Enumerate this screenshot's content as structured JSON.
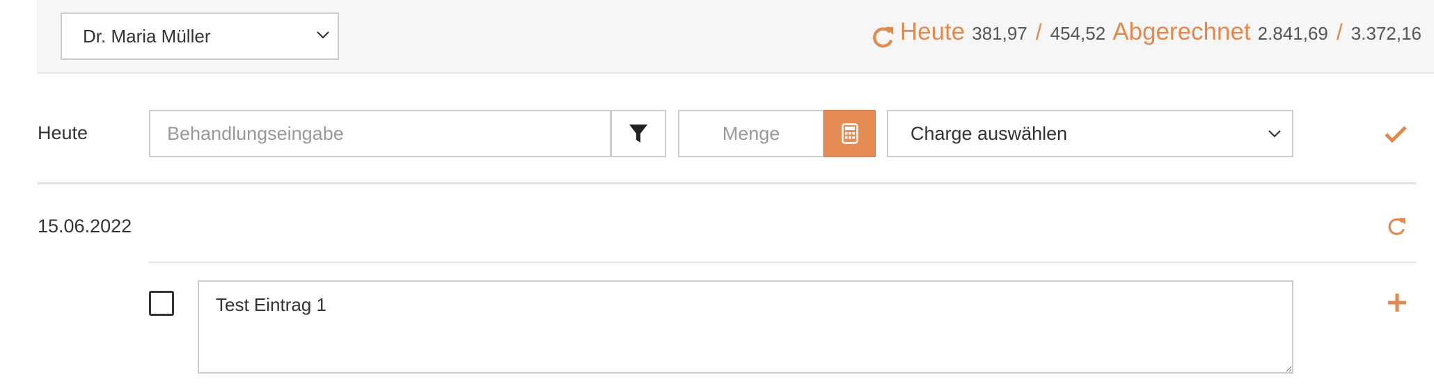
{
  "header": {
    "doctor_select": {
      "value": "Dr. Maria Müller"
    },
    "totals": {
      "today_label": "Heute",
      "today_value": "381,97",
      "today_total": "454,52",
      "billed_label": "Abgerechnet",
      "billed_value": "2.841,69",
      "billed_total": "3.372,16",
      "separator": "/"
    }
  },
  "entry": {
    "row_label": "Heute",
    "behandlung_placeholder": "Behandlungseingabe",
    "menge_placeholder": "Menge",
    "charge_select_value": "Charge auswählen"
  },
  "day": {
    "date": "15.06.2022",
    "items": [
      {
        "text": "Test Eintrag 1",
        "checked": false
      }
    ]
  },
  "colors": {
    "accent": "#e08a50",
    "accent_button": "#e58c55",
    "border": "#cccccc",
    "topbar_bg": "#f6f6f6"
  },
  "icons": {
    "refresh": "refresh-icon",
    "filter": "filter-icon",
    "calculator": "calculator-icon",
    "check": "check-icon",
    "plus": "plus-icon",
    "chevron": "chevron-down-icon"
  }
}
